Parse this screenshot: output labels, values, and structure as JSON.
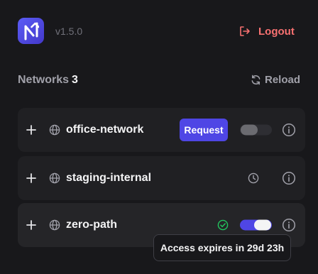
{
  "header": {
    "version": "v1.5.0",
    "logout_label": "Logout"
  },
  "networks_section": {
    "title": "Networks",
    "count": "3",
    "reload_label": "Reload"
  },
  "networks": [
    {
      "name": "office-network",
      "action_label": "Request",
      "toggle": "off"
    },
    {
      "name": "staging-internal",
      "status_icon": "clock-icon"
    },
    {
      "name": "zero-path",
      "status_icon": "check-circle-icon",
      "toggle": "on"
    }
  ],
  "tooltip": {
    "text": "Access expires in 29d 23h"
  },
  "colors": {
    "accent": "#4f46e5",
    "danger": "#f87171",
    "success": "#22c55e"
  }
}
